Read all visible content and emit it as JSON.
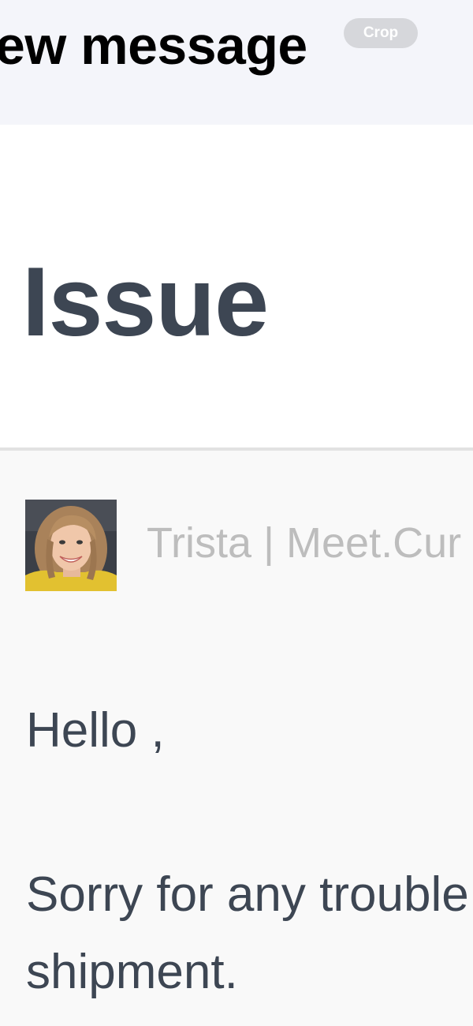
{
  "header": {
    "title": "ew message",
    "crop_label": "Crop"
  },
  "email": {
    "subject": "Issue",
    "sender": "Trista | Meet.Cur",
    "avatar_icon": "person-avatar-photo",
    "body_lines": [
      "Hello ,",
      "Sorry for any trouble",
      "shipment."
    ]
  },
  "colors": {
    "header_bg": "#f4f5fa",
    "subject_text": "#3d4653",
    "sender_text": "#bdbdbd",
    "message_bg": "#f9f9f9",
    "crop_pill": "#d6d7db"
  }
}
